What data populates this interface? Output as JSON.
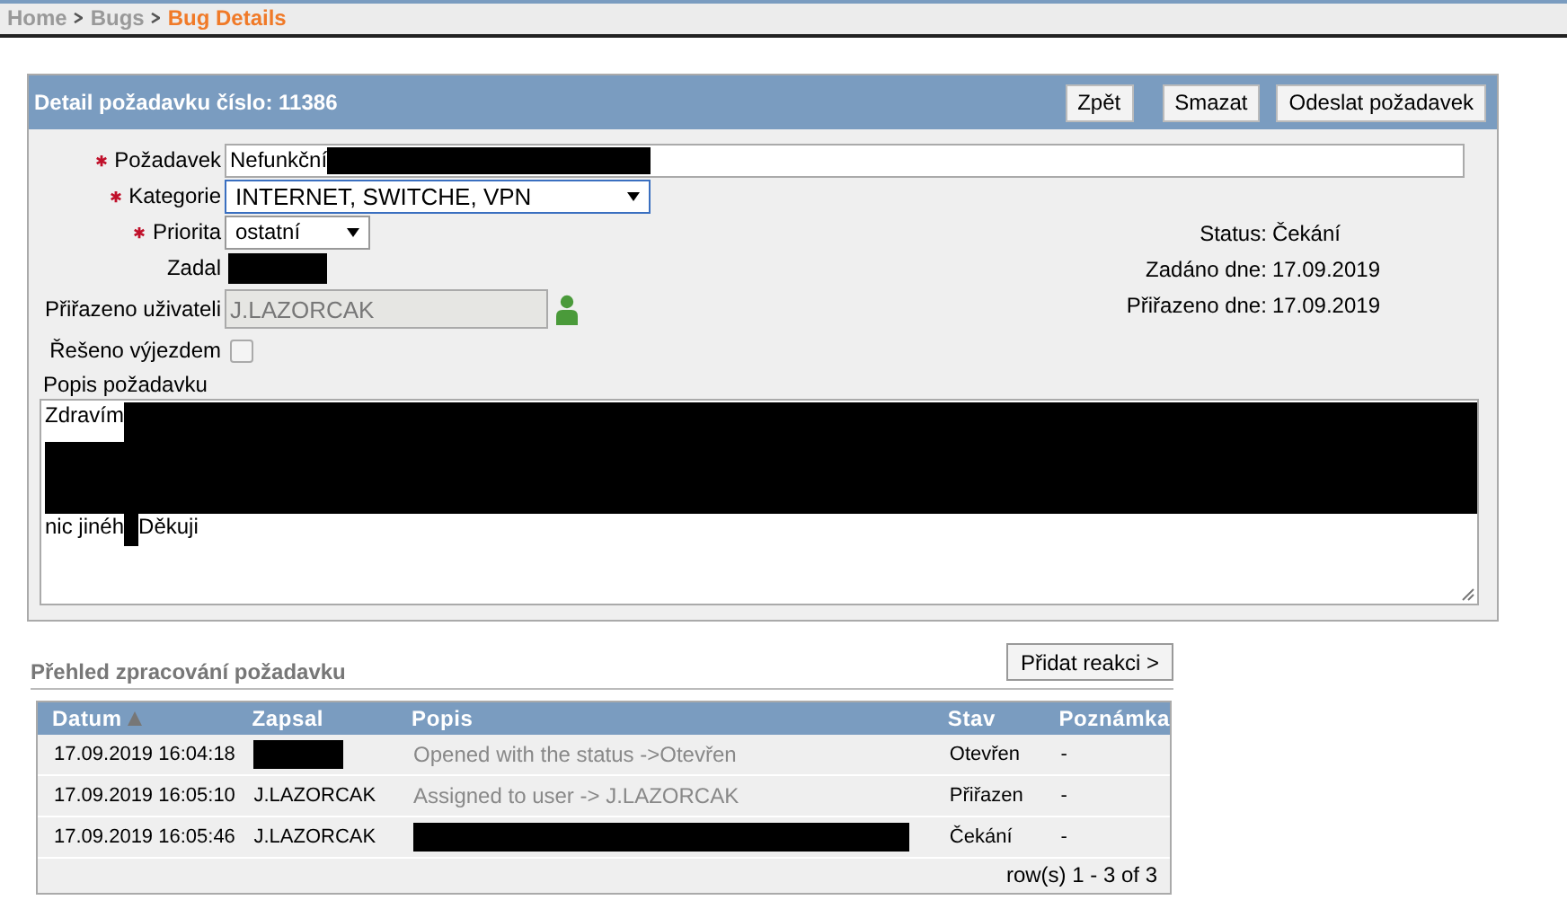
{
  "breadcrumb": [
    {
      "label": "Home",
      "selected": false
    },
    {
      "label": "Bugs",
      "selected": false
    },
    {
      "label": "Bug Details",
      "selected": true
    }
  ],
  "panel": {
    "title": "Detail požadavku číslo: 11386",
    "buttons": [
      "Zpět",
      "Smazat",
      "Odeslat požadavek"
    ]
  },
  "form": {
    "fields": [
      {
        "kind": "text",
        "label": "Požadavek",
        "required": true,
        "value_parts": [
          {
            "kind": "text",
            "text": "Nefunkční"
          },
          {
            "kind": "redaction"
          }
        ]
      },
      {
        "kind": "select",
        "label": "Kategorie",
        "required": true,
        "value": "INTERNET, SWITCHE, VPN"
      },
      {
        "kind": "select",
        "label": "Priorita",
        "required": true,
        "value": "ostatní"
      },
      {
        "kind": "plain",
        "label": "Zadal",
        "required": false,
        "value_parts": [
          {
            "kind": "redaction"
          }
        ]
      },
      {
        "kind": "readonly",
        "label": "Přiřazeno uživateli",
        "required": false,
        "value": "J.LAZORCAK"
      },
      {
        "kind": "checkbox",
        "label": "Řešeno výjezdem",
        "required": false,
        "checked": false
      }
    ],
    "info": [
      {
        "label": "Status:",
        "value": "Čekání"
      },
      {
        "label": "Zadáno dne:",
        "value": "17.09.2019"
      },
      {
        "label": "Přiřazeno dne:",
        "value": "17.09.2019"
      }
    ],
    "description": {
      "label": "Popis požadavku",
      "lines": [
        [
          {
            "kind": "text",
            "text": "Zdravím"
          },
          {
            "kind": "redaction"
          }
        ],
        [
          {
            "kind": "redaction"
          }
        ],
        [
          {
            "kind": "text",
            "text": "nic jinéh"
          },
          {
            "kind": "redaction"
          },
          {
            "kind": "text",
            "text": "Děkuji"
          }
        ]
      ]
    }
  },
  "history": {
    "title": "Přehled zpracování požadavku",
    "add_button": "Přidat reakci >",
    "columns": [
      {
        "label": "Datum",
        "sorted": true
      },
      {
        "label": "Zapsal",
        "sorted": false
      },
      {
        "label": "Popis",
        "sorted": false
      },
      {
        "label": "Stav",
        "sorted": false
      },
      {
        "label": "Poznámka",
        "sorted": false
      }
    ],
    "rows": [
      [
        {
          "kind": "text",
          "text": "17.09.2019 16:04:18"
        },
        {
          "kind": "redaction"
        },
        {
          "kind": "text",
          "text": "Opened with the status ->Otevřen"
        },
        {
          "kind": "text",
          "text": "Otevřen"
        },
        {
          "kind": "text",
          "text": "-"
        }
      ],
      [
        {
          "kind": "text",
          "text": "17.09.2019 16:05:10"
        },
        {
          "kind": "text",
          "text": "J.LAZORCAK"
        },
        {
          "kind": "text",
          "text": "Assigned to user -> J.LAZORCAK"
        },
        {
          "kind": "text",
          "text": "Přiřazen"
        },
        {
          "kind": "text",
          "text": "-"
        }
      ],
      [
        {
          "kind": "text",
          "text": "17.09.2019 16:05:46"
        },
        {
          "kind": "text",
          "text": "J.LAZORCAK"
        },
        {
          "kind": "redaction"
        },
        {
          "kind": "text",
          "text": "Čekání"
        },
        {
          "kind": "text",
          "text": "-"
        }
      ]
    ],
    "pager": "row(s) 1 - 3 of 3"
  }
}
